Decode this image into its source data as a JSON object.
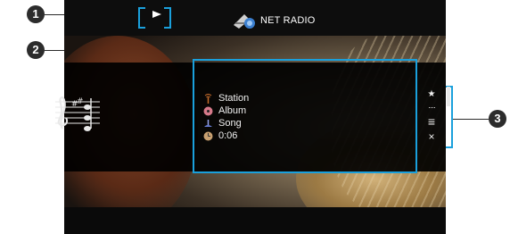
{
  "header": {
    "source_label": "NET RADIO",
    "playback_state_icon": "play-icon",
    "source_icon": "net-radio-icon"
  },
  "info": {
    "rows": [
      {
        "icon": "station-icon",
        "label": "Station"
      },
      {
        "icon": "album-icon",
        "label": "Album"
      },
      {
        "icon": "song-icon",
        "label": "Song"
      },
      {
        "icon": "elapsed-time-icon",
        "label": "0:06"
      }
    ]
  },
  "menu": {
    "items": [
      {
        "icon": "star-icon",
        "glyph": "★"
      },
      {
        "icon": "dots-icon",
        "glyph": "····"
      },
      {
        "icon": "list-icon",
        "glyph": "≡"
      },
      {
        "icon": "close-icon",
        "glyph": "×"
      }
    ]
  },
  "callouts": [
    "1",
    "2",
    "3"
  ],
  "colors": {
    "accent": "#1aa0dc",
    "badge": "#2c2c2c",
    "text": "#f0f0f0"
  }
}
